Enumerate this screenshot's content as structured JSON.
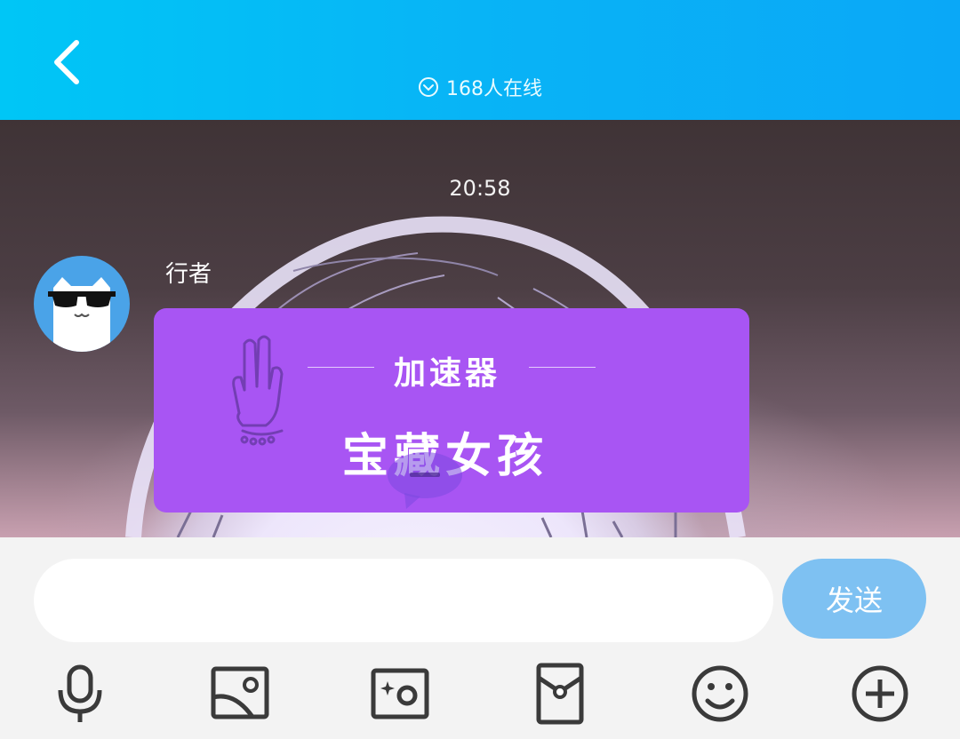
{
  "header": {
    "back_icon": "chevron-left-icon",
    "online_icon": "circle-chevron-down-icon",
    "online_text": "168人在线"
  },
  "chat": {
    "timestamp": "20:58",
    "message": {
      "sender": "行者",
      "avatar_icon": "cat-sunglasses-avatar",
      "card": {
        "title": "加速器",
        "main_text": "宝藏女孩",
        "background_color": "#a855f3"
      }
    }
  },
  "input": {
    "value": "",
    "placeholder": "",
    "send_label": "发送"
  },
  "toolbar": {
    "items": [
      {
        "icon": "microphone-icon"
      },
      {
        "icon": "image-icon"
      },
      {
        "icon": "camera-icon"
      },
      {
        "icon": "red-envelope-icon"
      },
      {
        "icon": "emoji-icon"
      },
      {
        "icon": "plus-circle-icon"
      }
    ]
  },
  "colors": {
    "header_start": "#00c6f6",
    "header_end": "#0aa8f7",
    "send_button": "#7ec1f2",
    "icon_gray": "#3a3a3a"
  }
}
